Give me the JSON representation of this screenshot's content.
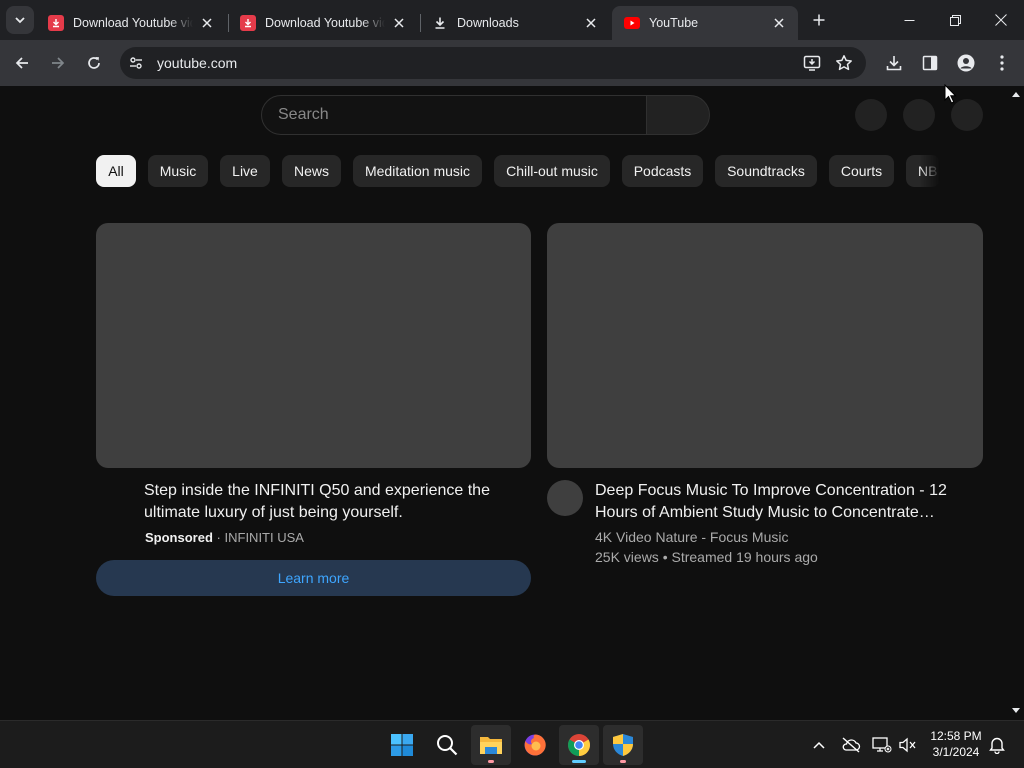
{
  "browser": {
    "tabs": [
      {
        "title": "Download Youtube vid",
        "icon": "download-app-icon"
      },
      {
        "title": "Download Youtube vid",
        "icon": "download-app-icon"
      },
      {
        "title": "Downloads",
        "icon": "download-arrow-icon"
      },
      {
        "title": "YouTube",
        "icon": "youtube-icon",
        "active": true
      }
    ],
    "url": "youtube.com"
  },
  "youtube": {
    "search_placeholder": "Search",
    "chips": [
      "All",
      "Music",
      "Live",
      "News",
      "Meditation music",
      "Chill-out music",
      "Podcasts",
      "Soundtracks",
      "Courts",
      "NB"
    ],
    "selected_chip": "All",
    "ad": {
      "title": "Step inside the INFINITI Q50 and experience the ultimate luxury of just being yourself.",
      "sponsored_label": "Sponsored",
      "separator": "·",
      "advertiser": "INFINITI USA",
      "cta": "Learn more"
    },
    "video": {
      "title": "Deep Focus Music To Improve Concentration - 12 Hours of Ambient Study Music to Concentrate…",
      "channel": "4K Video Nature - Focus Music",
      "stats": "25K views • Streamed 19 hours ago"
    }
  },
  "taskbar": {
    "time": "12:58 PM",
    "date": "3/1/2024"
  },
  "colors": {
    "youtube_red": "#ff0000",
    "link_blue": "#3ea6ff",
    "download_app_red": "#e53b4a"
  }
}
